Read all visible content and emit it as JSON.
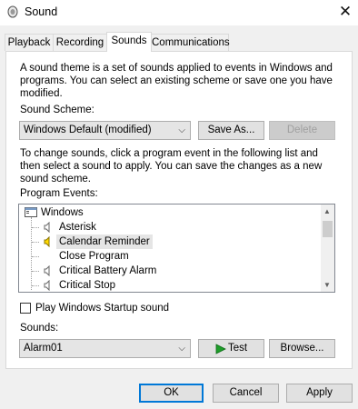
{
  "window": {
    "title": "Sound",
    "close_glyph": "✕"
  },
  "tabs": [
    {
      "label": "Playback"
    },
    {
      "label": "Recording"
    },
    {
      "label": "Sounds",
      "active": true
    },
    {
      "label": "Communications"
    }
  ],
  "intro_text": "A sound theme is a set of sounds applied to events in Windows and programs.  You can select an existing scheme or save one you have modified.",
  "scheme": {
    "label": "Sound Scheme:",
    "value": "Windows Default (modified)",
    "save_as": "Save As...",
    "delete": "Delete"
  },
  "instructions": "To change sounds, click a program event in the following list and then select a sound to apply.  You can save the changes as a new sound scheme.",
  "events": {
    "label": "Program Events:",
    "items": [
      {
        "label": "Windows",
        "icon": "windows-icon",
        "level": 0
      },
      {
        "label": "Asterisk",
        "icon": "speaker-icon",
        "level": 1
      },
      {
        "label": "Calendar Reminder",
        "icon": "speaker-icon",
        "level": 1,
        "selected": true
      },
      {
        "label": "Close Program",
        "icon": "none",
        "level": 1
      },
      {
        "label": "Critical Battery Alarm",
        "icon": "speaker-icon",
        "level": 1
      },
      {
        "label": "Critical Stop",
        "icon": "speaker-icon",
        "level": 1
      }
    ]
  },
  "startup_checkbox": {
    "label": "Play Windows Startup sound",
    "checked": false
  },
  "sounds": {
    "label": "Sounds:",
    "value": "Alarm01",
    "test": "Test",
    "browse": "Browse..."
  },
  "footer": {
    "ok": "OK",
    "cancel": "Cancel",
    "apply": "Apply"
  },
  "colors": {
    "accent": "#0078d7",
    "selected_speaker": "#ffd800"
  }
}
